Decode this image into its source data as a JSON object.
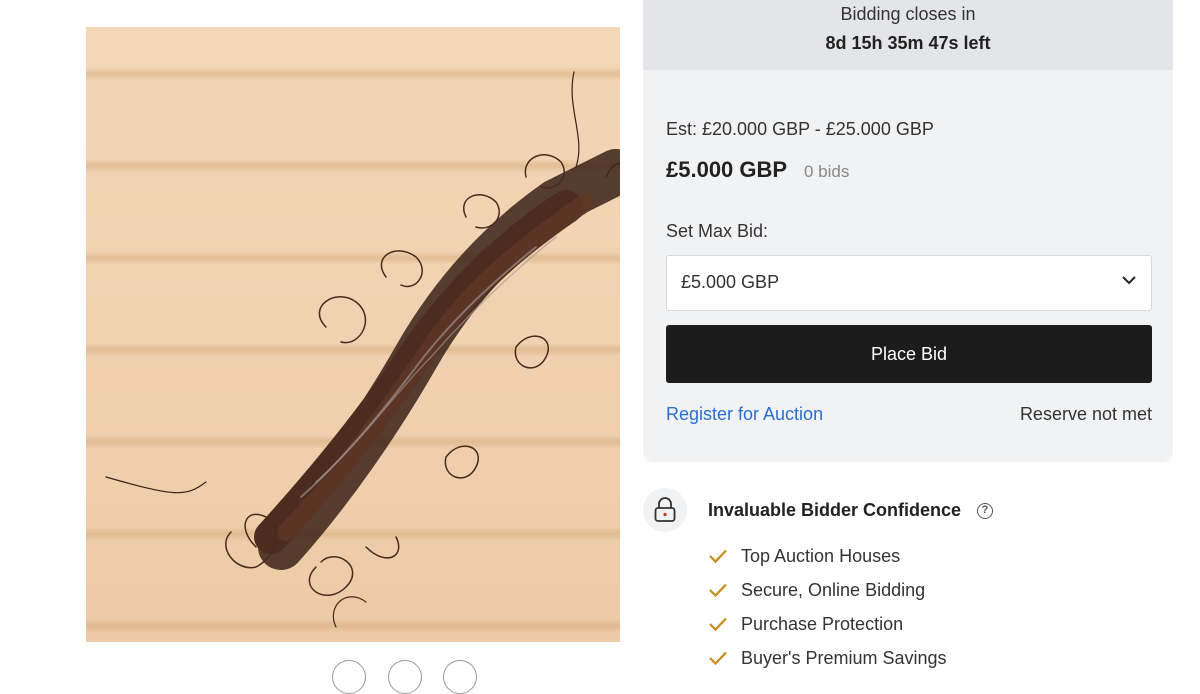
{
  "lot_image": {
    "icon": "lot-photo-hair-on-wood"
  },
  "bidding": {
    "closes_label": "Bidding closes in",
    "time_left": "8d 15h 35m 47s left",
    "estimate": "Est: £20.000 GBP - £25.000 GBP",
    "current_bid": "£5.000 GBP",
    "bid_count": "0 bids",
    "max_bid_label": "Set Max Bid:",
    "max_bid_value": "£5.000 GBP",
    "place_bid_label": "Place Bid",
    "register_link": "Register for Auction",
    "reserve_status": "Reserve not met"
  },
  "confidence": {
    "title": "Invaluable Bidder Confidence",
    "help_icon": "?",
    "features": [
      {
        "label": "Top Auction Houses"
      },
      {
        "label": "Secure, Online Bidding"
      },
      {
        "label": "Purchase Protection"
      },
      {
        "label": "Buyer's Premium Savings"
      }
    ]
  },
  "colors": {
    "link": "#2a6ed3",
    "button_bg": "#1c1c1c",
    "check": "#c98a1b",
    "card_bg": "#f1f2f4"
  }
}
